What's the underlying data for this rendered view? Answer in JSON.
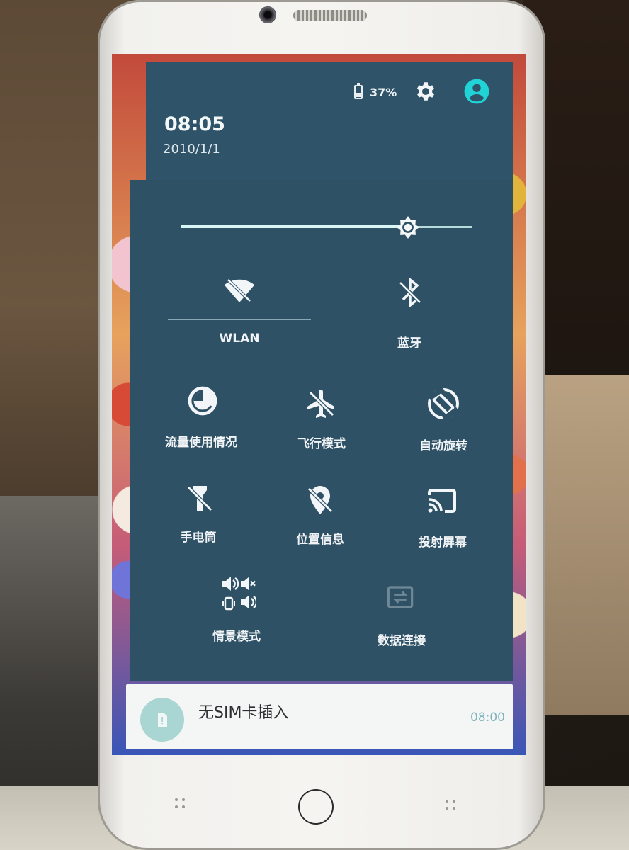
{
  "status_bar": {
    "battery_percent": "37%",
    "battery_icon": "battery-icon",
    "settings_icon": "gear-icon",
    "account_icon": "account-circle-icon",
    "accent": "#1fd3d6"
  },
  "header": {
    "time": "08:05",
    "date": "2010/1/1"
  },
  "brightness": {
    "level": 0.78,
    "icon": "brightness-icon"
  },
  "tiles": [
    {
      "id": "wlan",
      "label": "WLAN",
      "icon": "wifi-off-icon",
      "enabled": false
    },
    {
      "id": "bluetooth",
      "label": "蓝牙",
      "icon": "bluetooth-off-icon",
      "enabled": false
    },
    {
      "id": "data-usage",
      "label": "流量使用情况",
      "icon": "data-usage-icon",
      "enabled": true
    },
    {
      "id": "airplane",
      "label": "飞行模式",
      "icon": "airplane-off-icon",
      "enabled": false
    },
    {
      "id": "auto-rotate",
      "label": "自动旋转",
      "icon": "rotate-icon",
      "enabled": true
    },
    {
      "id": "flashlight",
      "label": "手电筒",
      "icon": "flashlight-off-icon",
      "enabled": false
    },
    {
      "id": "location",
      "label": "位置信息",
      "icon": "location-off-icon",
      "enabled": false
    },
    {
      "id": "cast",
      "label": "投射屏幕",
      "icon": "cast-icon",
      "enabled": true
    },
    {
      "id": "sound-profile",
      "label": "情景模式",
      "icon": "sound-profile-icon",
      "enabled": true
    },
    {
      "id": "mobile-data",
      "label": "数据连接",
      "icon": "data-transfer-icon",
      "enabled": false
    }
  ],
  "notification": {
    "title": "无SIM卡插入",
    "time": "08:00",
    "icon": "sim-card-icon"
  },
  "colors": {
    "shade": "#2f5166",
    "icon_white": "#f2f6f8",
    "icon_dim": "#6f8896",
    "notif_bg": "#f4f6f6"
  }
}
